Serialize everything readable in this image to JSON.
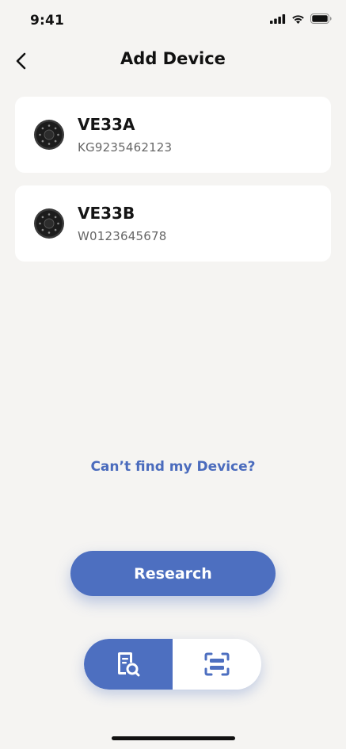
{
  "status_bar": {
    "time": "9:41"
  },
  "header": {
    "title": "Add Device",
    "back_icon": "chevron-left-icon"
  },
  "devices": [
    {
      "name": "VE33A",
      "serial": "KG9235462123",
      "icon": "smart-lock-icon"
    },
    {
      "name": "VE33B",
      "serial": "W0123645678",
      "icon": "smart-lock-icon"
    }
  ],
  "links": {
    "cant_find": "Can’t find my Device?"
  },
  "actions": {
    "research_label": "Research"
  },
  "mode_toggle": {
    "left_icon": "search-document-icon",
    "right_icon": "scan-icon",
    "selected": "left"
  },
  "colors": {
    "accent": "#4d6fc0",
    "link": "#4a6bbd",
    "background": "#f5f4f2",
    "card": "#ffffff"
  }
}
